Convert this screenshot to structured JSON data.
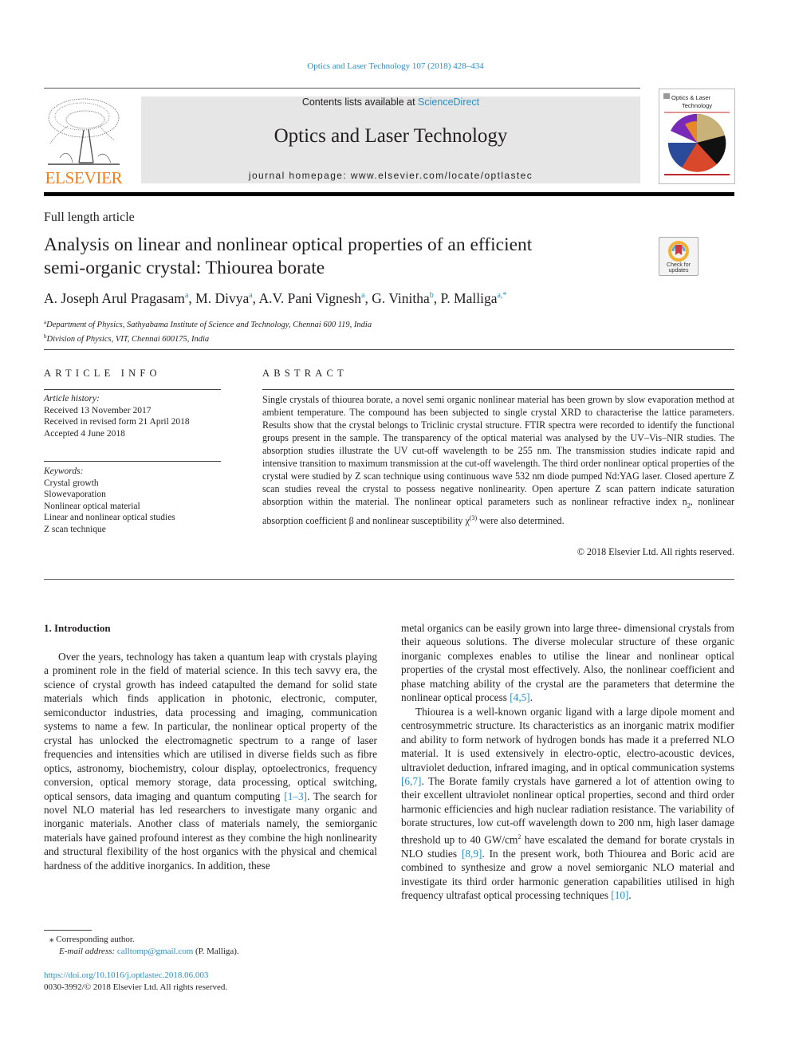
{
  "header": {
    "citation": "Optics and Laser Technology 107 (2018) 428–434",
    "contents_prefix": "Contents lists available at ",
    "contents_link": "ScienceDirect",
    "journal_title": "Optics and Laser Technology",
    "homepage_prefix": "journal homepage: ",
    "homepage_url": "www.elsevier.com/locate/optlastec",
    "publisher_logo_text": "ELSEVIER",
    "cover_title_line1": "Optics & Laser",
    "cover_title_line2": "Technology",
    "check_updates_line1": "Check for",
    "check_updates_line2": "updates"
  },
  "article": {
    "type": "Full length article",
    "title_line1": "Analysis on linear and nonlinear optical properties of an efficient",
    "title_line2": "semi-organic crystal: Thiourea borate",
    "authors": [
      {
        "name": "A. Joseph Arul Pragasam",
        "aff": "a"
      },
      {
        "name": "M. Divya",
        "aff": "a"
      },
      {
        "name": "A.V. Pani Vignesh",
        "aff": "a"
      },
      {
        "name": "G. Vinitha",
        "aff": "b"
      },
      {
        "name": "P. Malliga",
        "aff": "a,*"
      }
    ],
    "affiliations": [
      {
        "key": "a",
        "text": "Department of Physics, Sathyabama Institute of Science and Technology, Chennai 600 119, India"
      },
      {
        "key": "b",
        "text": "Division of Physics, VIT, Chennai 600175, India"
      }
    ]
  },
  "article_info": {
    "heading": "ARTICLE INFO",
    "history_label": "Article history:",
    "history": [
      "Received 13 November 2017",
      "Received in revised form 21 April 2018",
      "Accepted 4 June 2018"
    ],
    "keywords_label": "Keywords:",
    "keywords": [
      "Crystal growth",
      "Slowevaporation",
      "Nonlinear optical material",
      "Linear and nonlinear optical studies",
      "Z scan technique"
    ]
  },
  "abstract": {
    "heading": "ABSTRACT",
    "text_part1": "Single crystals of thiourea borate, a novel semi organic nonlinear material has been grown by slow evaporation method at ambient temperature. The compound has been subjected to single crystal XRD to characterise the lattice parameters. Results show that the crystal belongs to Triclinic crystal structure. FTIR spectra were recorded to identify the functional groups present in the sample. The transparency of the optical material was analysed by the UV–Vis–NIR studies. The absorption studies illustrate the UV cut-off wavelength to be 255 nm. The transmission studies indicate rapid and intensive transition to maximum transmission at the cut-off wavelength. The third order nonlinear optical properties of the crystal were studied by Z scan technique using continuous wave 532 nm diode pumped Nd:YAG laser. Closed aperture Z scan studies reveal the crystal to possess negative nonlinearity. Open aperture Z scan pattern indicate saturation absorption within the material. The nonlinear optical parameters such as nonlinear refractive index n",
    "sub_2": "2",
    "text_part2": ", nonlinear absorption coefficient β and nonlinear susceptibility χ",
    "sup_3": "(3)",
    "text_part3": " were also determined.",
    "copyright": "© 2018 Elsevier Ltd. All rights reserved."
  },
  "introduction": {
    "heading": "1. Introduction",
    "p1_a": "Over the years, technology has taken a quantum leap with crystals playing a prominent role in the field of material science. In this tech savvy era, the science of crystal growth has indeed catapulted the demand for solid state materials which finds application in photonic, electronic, computer, semiconductor industries, data processing and imaging, communication systems to name a few. In particular, the nonlinear optical property of the crystal has unlocked the electromagnetic spectrum to a range of laser frequencies and intensities which are utilised in diverse fields such as fibre optics, astronomy, biochemistry, colour display, optoelectronics, frequency conversion, optical memory storage, data processing, optical switching, optical sensors, data imaging and quantum computing ",
    "ref1": "[1–3]",
    "p1_b": ". The search for novel NLO material has led researchers to investigate many organic and inorganic materials. Another class of materials namely, the semiorganic materials have gained profound interest as they combine the high nonlinearity and structural flexibility of the host organics with the physical and chemical hardness of the additive inorganics. In addition, these",
    "p1_c": "metal organics can be easily grown into large three- dimensional crystals from their aqueous solutions. The diverse molecular structure of these organic inorganic complexes enables to utilise the linear and nonlinear optical properties of the crystal most effectively. Also, the nonlinear coefficient and phase matching ability of the crystal are the parameters that determine the nonlinear optical process ",
    "ref2": "[4,5]",
    "p1_d": ".",
    "p2_a": "Thiourea is a well-known organic ligand with a large dipole moment and centrosymmetric structure. Its characteristics as an inorganic matrix modifier and ability to form network of hydrogen bonds has made it a preferred NLO material. It is used extensively in electro-optic, electro-acoustic devices, ultraviolet deduction, infrared imaging, and in optical communication systems ",
    "ref3": "[6,7]",
    "p2_b": ". The Borate family crystals have garnered a lot of attention owing to their excellent ultraviolet nonlinear optical properties, second and third order harmonic efficiencies and high nuclear radiation resistance. The variability of borate structures, low cut-off wavelength down to 200 nm, high laser damage threshold up to 40 GW/cm",
    "p2_sup": "2",
    "p2_c": " have escalated the demand for borate crystals in NLO studies ",
    "ref4": "[8,9]",
    "p2_d": ". In the present work, both Thiourea and Boric acid are combined to synthesize and grow a novel semiorganic NLO material and investigate its third order harmonic generation capabilities utilised in high frequency ultrafast optical processing techniques ",
    "ref5": "[10]",
    "p2_e": "."
  },
  "footnotes": {
    "star": "⁎",
    "corresponding": "Corresponding author.",
    "email_label": "E-mail address: ",
    "email": "calltomp@gmail.com",
    "email_owner": " (P. Malliga).",
    "doi": "https://doi.org/10.1016/j.optlastec.2018.06.003",
    "issn_line": "0030-3992/© 2018 Elsevier Ltd. All rights reserved."
  },
  "colors": {
    "link": "#2a8fc2",
    "elsevier_orange": "#f07e1c",
    "journal_box": "#e6e6e6"
  }
}
